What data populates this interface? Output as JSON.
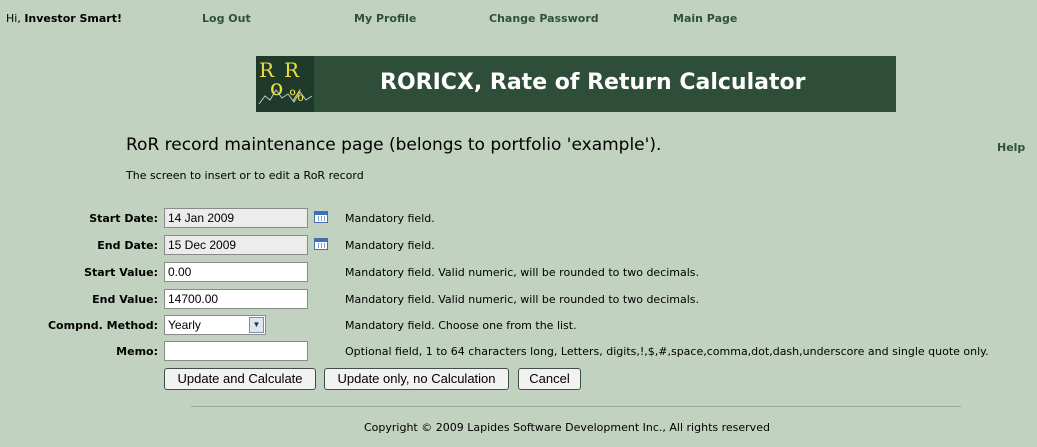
{
  "header": {
    "greeting_prefix": "Hi,",
    "user_name": "Investor Smart!",
    "nav": [
      "Log Out",
      "My Profile",
      "Change Password",
      "Main Page"
    ]
  },
  "banner": {
    "logo_text": "RoR",
    "title": "RORICX, Rate of Return Calculator"
  },
  "page": {
    "title": "RoR record maintenance page (belongs to portfolio 'example').",
    "help": "Help",
    "subtitle": "The screen to insert or to edit a RoR record"
  },
  "form": {
    "start_date": {
      "label": "Start Date:",
      "value": "14 Jan 2009",
      "note": "Mandatory field."
    },
    "end_date": {
      "label": "End Date:",
      "value": "15 Dec 2009",
      "note": "Mandatory field."
    },
    "start_value": {
      "label": "Start Value:",
      "value": "0.00",
      "note": "Mandatory field. Valid numeric, will be rounded to two decimals."
    },
    "end_value": {
      "label": "End Value:",
      "value": "14700.00",
      "note": "Mandatory field. Valid numeric, will be rounded to two decimals."
    },
    "method": {
      "label": "Compnd. Method:",
      "value": "Yearly",
      "note": "Mandatory field. Choose one from the list."
    },
    "memo": {
      "label": "Memo:",
      "value": "",
      "note": "Optional field, 1 to 64 characters long, Letters, digits,!,$,#,space,comma,dot,dash,underscore and single quote only."
    }
  },
  "buttons": {
    "update_calc": "Update and Calculate",
    "update_only": "Update only, no Calculation",
    "cancel": "Cancel"
  },
  "footer": {
    "copyright": "Copyright © 2009 Lapides Software Development Inc., All rights reserved"
  }
}
